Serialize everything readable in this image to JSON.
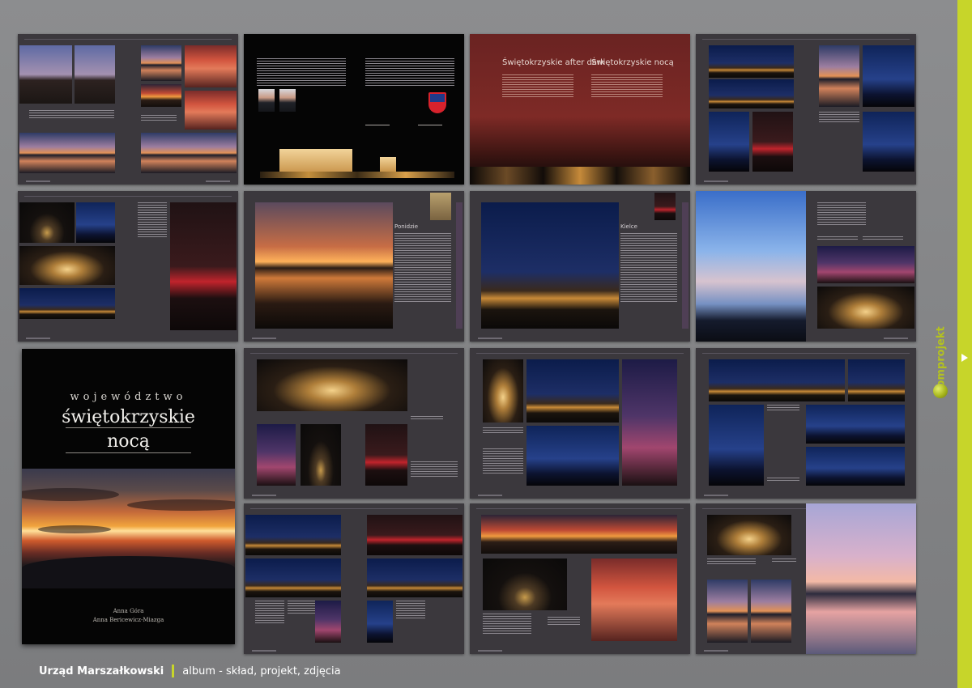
{
  "cover": {
    "line1": "województwo",
    "line2": "świętokrzyskie",
    "line3": "nocą",
    "author1": "Anna Góra",
    "author2": "Anna Bericewicz-Miazga"
  },
  "spread3": {
    "heading_en": "Świętokrzyskie after dark",
    "heading_pl": "Świętokrzyskie nocą"
  },
  "spread6": {
    "heading": "Ponidzie"
  },
  "spread7": {
    "heading": "Kielce"
  },
  "footer": {
    "client": "Urząd Marszałkowski",
    "description": "album - skład, projekt, zdjęcia"
  },
  "sidebar": {
    "logo_text": "abmprojekt"
  },
  "colors": {
    "accent": "#c7d52a",
    "spread_bg": "#3b383d",
    "page_bg": "#838486"
  }
}
